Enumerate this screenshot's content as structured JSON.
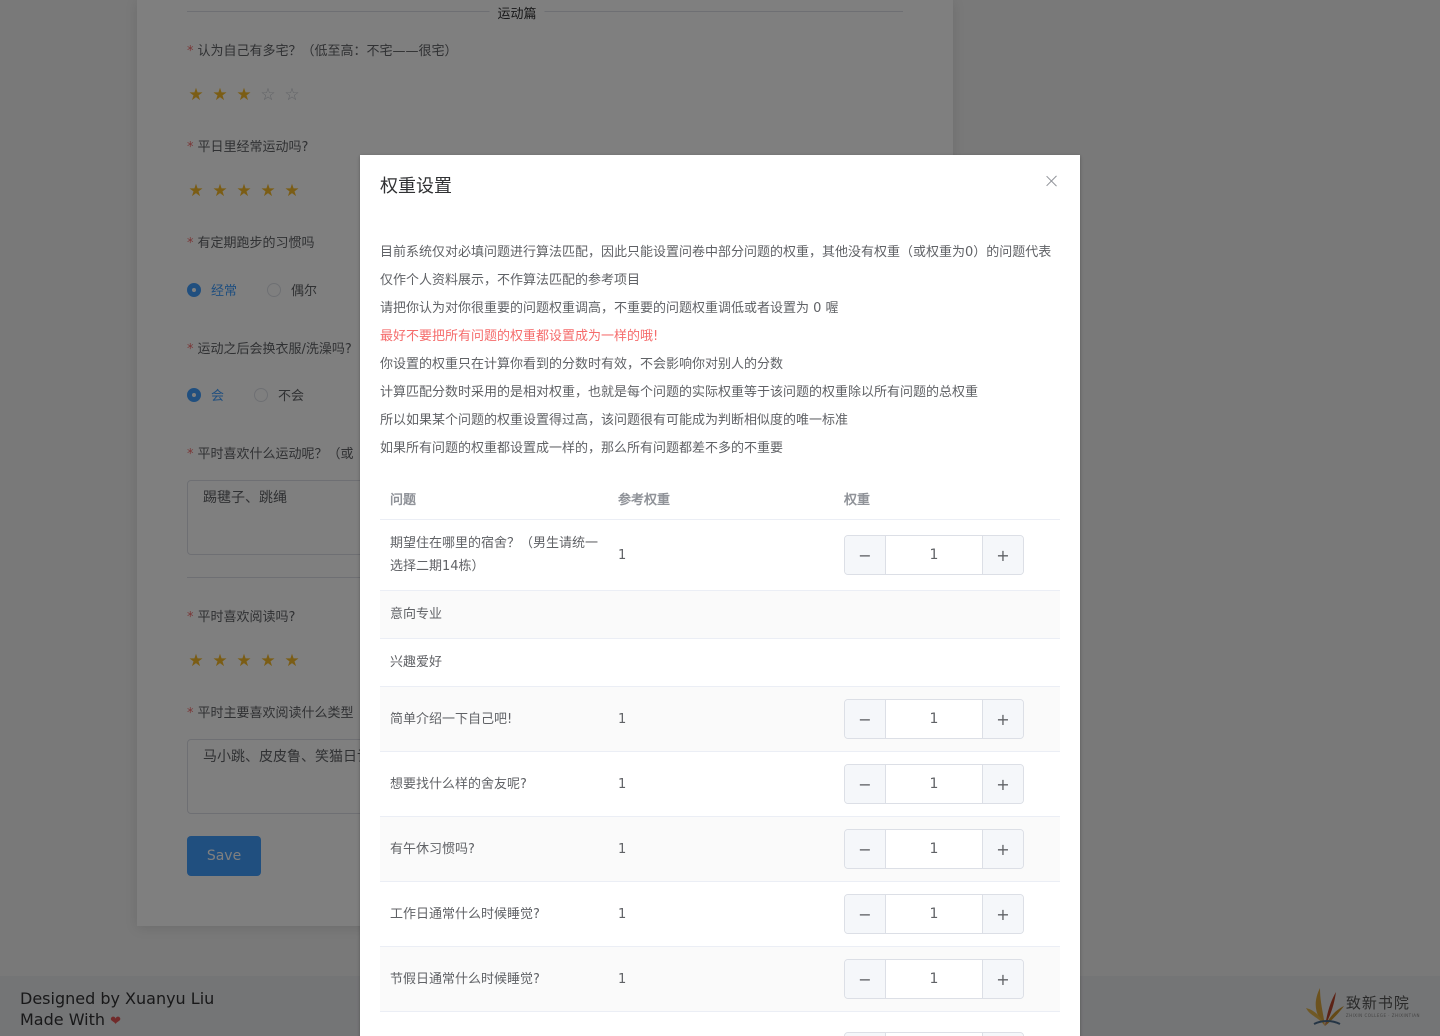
{
  "page": {
    "section_title": "运动篇",
    "questions": {
      "q1": "认为自己有多宅？（低至高：不宅——很宅）",
      "q2": "平日里经常运动吗?",
      "q3": "有定期跑步的习惯吗",
      "q4": "运动之后会换衣服/洗澡吗?",
      "q5": "平时喜欢什么运动呢？（或",
      "q6": "平时喜欢阅读吗?",
      "q7": "平时主要喜欢阅读什么类型"
    },
    "required_mark": "*",
    "rating_q1": 3,
    "rating_q2": 5,
    "rating_q6": 5,
    "star_glyph_on": "★",
    "star_glyph_off": "☆",
    "q3_options": [
      "经常",
      "偶尔"
    ],
    "q3_selected": "经常",
    "q4_options": [
      "会",
      "不会"
    ],
    "q4_selected": "会",
    "q5_answer": "踢毽子、跳绳",
    "q7_answer": "马小跳、皮皮鲁、笑猫日记",
    "save_label": "Save",
    "accent_color": "#409eff"
  },
  "footer": {
    "line1": "Designed by Xuanyu Liu",
    "line2": "Made With",
    "heart": "❤",
    "logo_cn": "致新书院",
    "logo_en": "ZHIXIN COLLEGE · ZHIXINTIAN"
  },
  "dialog": {
    "title": "权重设置",
    "intro": [
      "目前系统仅对必填问题进行算法匹配，因此只能设置问卷中部分问题的权重，其他没有权重（或权重为0）的问题代表仅作个人资料展示，不作算法匹配的参考项目",
      "请把你认为对你很重要的问题权重调高，不重要的问题权重调低或者设置为 0 喔",
      "最好不要把所有问题的权重都设置成为一样的哦!",
      "你设置的权重只在计算你看到的分数时有效，不会影响你对别人的分数",
      "计算匹配分数时采用的是相对权重，也就是每个问题的实际权重等于该问题的权重除以所有问题的总权重",
      "所以如果某个问题的权重设置得过高，该问题很有可能成为判断相似度的唯一标准",
      "如果所有问题的权重都设置成一样的，那么所有问题都差不多的不重要"
    ],
    "warning_color": "#f56c6c",
    "table": {
      "headers": [
        "问题",
        "参考权重",
        "权重"
      ],
      "rows": [
        {
          "question": "期望住在哪里的宿舍？（男生请统一选择二期14栋）",
          "ref": "1",
          "weight": "1"
        },
        {
          "question": "意向专业",
          "ref": "",
          "weight": ""
        },
        {
          "question": "兴趣爱好",
          "ref": "",
          "weight": ""
        },
        {
          "question": "简单介绍一下自己吧!",
          "ref": "1",
          "weight": "1"
        },
        {
          "question": "想要找什么样的舍友呢?",
          "ref": "1",
          "weight": "1"
        },
        {
          "question": "有午休习惯吗?",
          "ref": "1",
          "weight": "1"
        },
        {
          "question": "工作日通常什么时候睡觉?",
          "ref": "1",
          "weight": "1"
        },
        {
          "question": "节假日通常什么时候睡觉?",
          "ref": "1",
          "weight": "1"
        },
        {
          "question": "",
          "ref": "",
          "weight": ""
        }
      ],
      "minus": "−",
      "plus": "+"
    }
  }
}
